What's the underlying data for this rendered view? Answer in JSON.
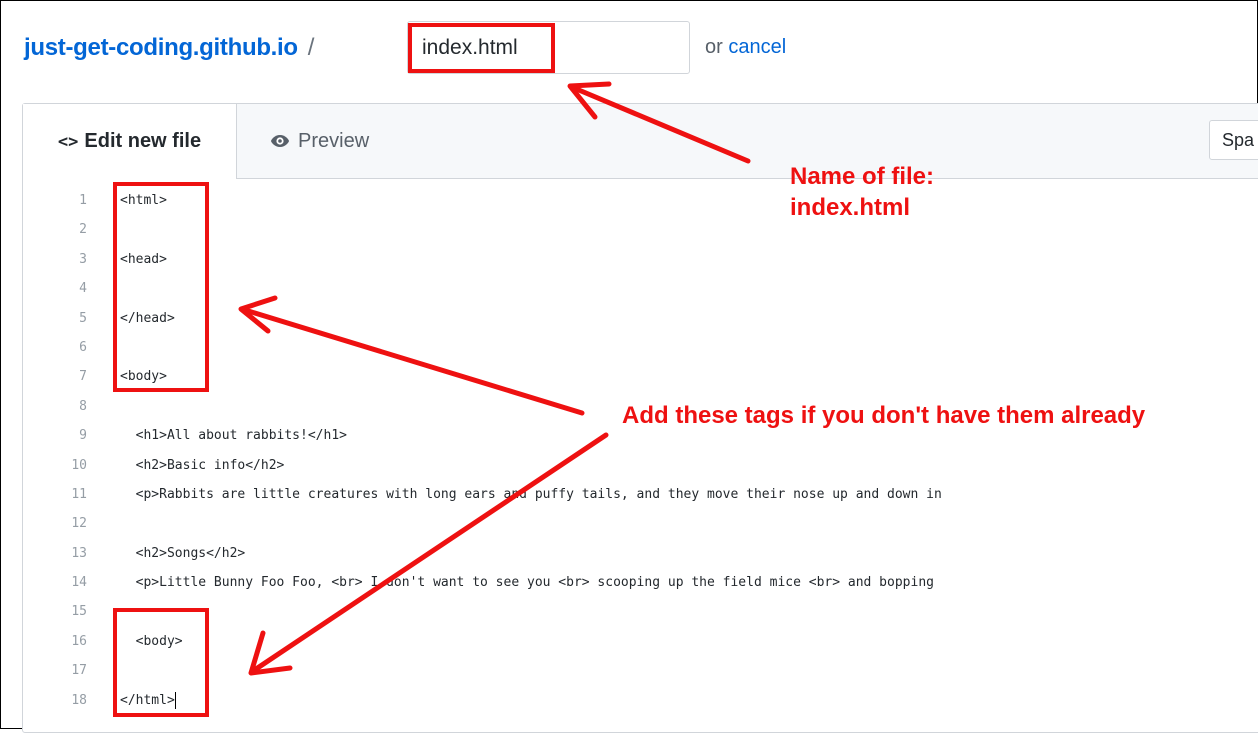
{
  "header": {
    "repo_name": "just-get-coding.github.io",
    "separator": "/",
    "filename_value": "index.html",
    "cancel_prefix": "or",
    "cancel_label": "cancel"
  },
  "tabs": {
    "edit_label": "Edit new file",
    "edit_icon_text": "<>",
    "preview_label": "Preview",
    "indent_select_value": "Spa"
  },
  "code_lines": [
    {
      "num": "1",
      "text": "<html>"
    },
    {
      "num": "2",
      "text": ""
    },
    {
      "num": "3",
      "text": "<head>"
    },
    {
      "num": "4",
      "text": ""
    },
    {
      "num": "5",
      "text": "</head>"
    },
    {
      "num": "6",
      "text": ""
    },
    {
      "num": "7",
      "text": "<body>"
    },
    {
      "num": "8",
      "text": ""
    },
    {
      "num": "9",
      "text": "  <h1>All about rabbits!</h1>"
    },
    {
      "num": "10",
      "text": "  <h2>Basic info</h2>"
    },
    {
      "num": "11",
      "text": "  <p>Rabbits are little creatures with long ears and puffy tails, and they move their nose up and down in"
    },
    {
      "num": "12",
      "text": ""
    },
    {
      "num": "13",
      "text": "  <h2>Songs</h2>"
    },
    {
      "num": "14",
      "text": "  <p>Little Bunny Foo Foo, <br> I don't want to see you <br> scooping up the field mice <br> and bopping"
    },
    {
      "num": "15",
      "text": ""
    },
    {
      "num": "16",
      "text": "  <body>"
    },
    {
      "num": "17",
      "text": ""
    },
    {
      "num": "18",
      "text": "</html>"
    }
  ],
  "annotations": {
    "filename_note_line1": "Name of file:",
    "filename_note_line2": "index.html",
    "tags_note": "Add these tags if you don't have them already",
    "color": "#ee1111"
  },
  "colors": {
    "link": "#0366d6",
    "tab_bar": "#f6f8fa",
    "border": "#d1d5da"
  }
}
